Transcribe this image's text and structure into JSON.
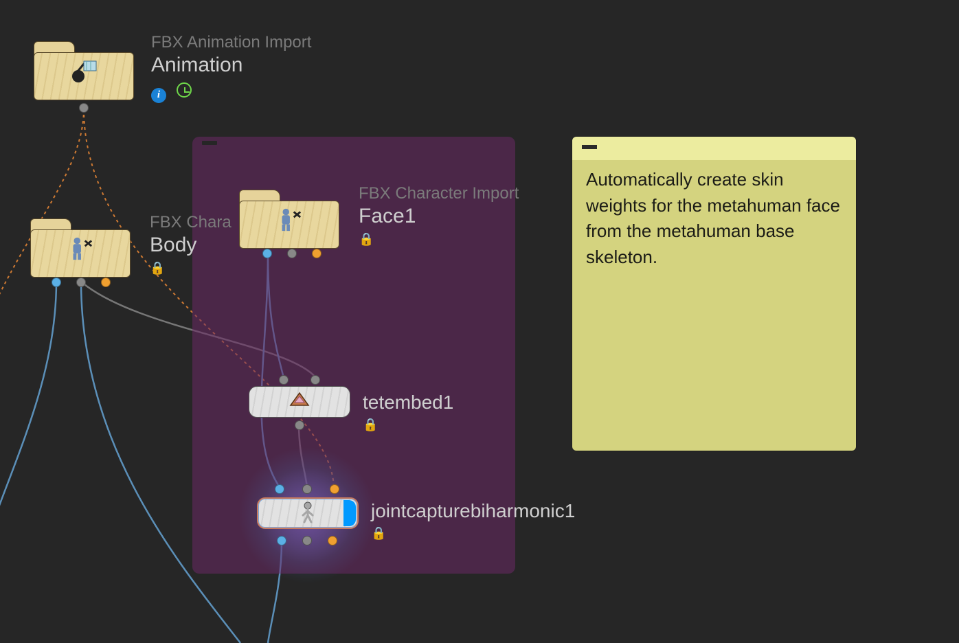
{
  "nodes": {
    "animation": {
      "subtitle": "FBX Animation Import",
      "title": "Animation",
      "icon": "fbx-animation-icon"
    },
    "body": {
      "subtitle": "FBX Chara",
      "title": "Body",
      "icon": "fbx-character-icon",
      "locked": true
    },
    "face1": {
      "subtitle": "FBX Character Import",
      "title": "Face1",
      "icon": "fbx-character-icon",
      "locked": true
    },
    "tetembed1": {
      "title": "tetembed1",
      "icon": "tet-embed-icon",
      "locked": true
    },
    "jointcapture": {
      "title": "jointcapturebiharmonic1",
      "icon": "joint-capture-icon",
      "locked": true,
      "selected": true,
      "display_flag": true
    }
  },
  "group_panel": {
    "color": "#652861"
  },
  "sticky": {
    "text": "Automatically create skin weights for the metahuman face from the metahuman base skeleton."
  },
  "connector_colors": {
    "blue": "#5bb0e6",
    "gray": "#888888",
    "orange": "#f0a030"
  },
  "wires": [
    {
      "from": "animation.out",
      "to": "offscreen-left-1",
      "style": "orange-dotted"
    },
    {
      "from": "animation.out",
      "to": "jointcapture.in3",
      "style": "orange-dotted"
    },
    {
      "from": "body.out_blue",
      "to": "offscreen-bottom-1",
      "style": "blue"
    },
    {
      "from": "body.out_gray",
      "to": "tetembed1.in2",
      "style": "gray"
    },
    {
      "from": "body.out_gray",
      "to": "offscreen-bottom-2",
      "style": "blue"
    },
    {
      "from": "face1.out_blue",
      "to": "tetembed1.in1",
      "style": "blue"
    },
    {
      "from": "face1.out_blue",
      "to": "jointcapture.in1",
      "style": "blue"
    },
    {
      "from": "tetembed1.out",
      "to": "jointcapture.in2",
      "style": "gray"
    },
    {
      "from": "jointcapture.out",
      "to": "offscreen-bottom-3",
      "style": "blue"
    }
  ]
}
